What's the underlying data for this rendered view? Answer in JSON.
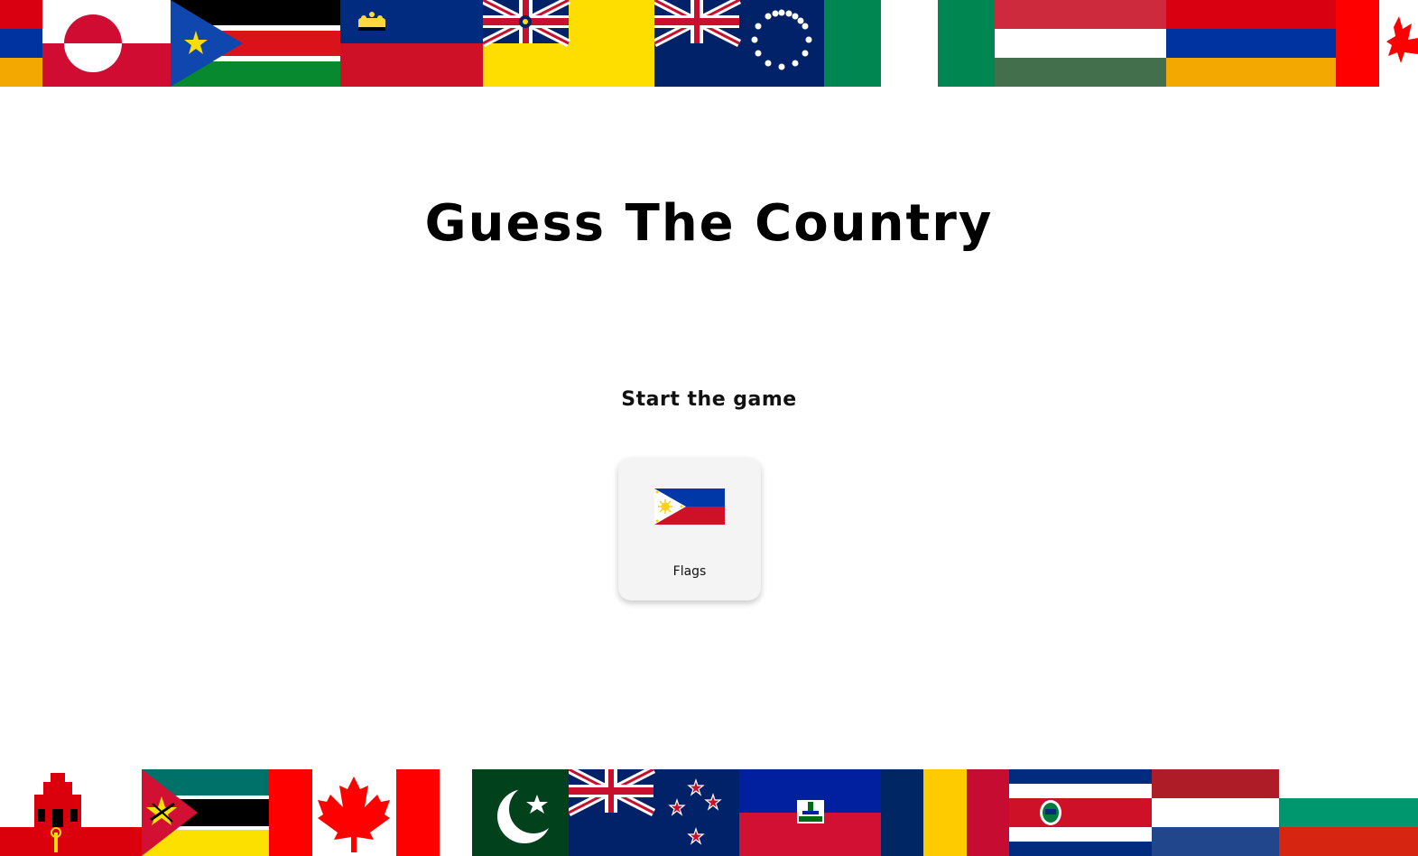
{
  "title": "Guess The Country",
  "subtitle": "Start the game",
  "modes": [
    {
      "label": "Flags",
      "icon": "philippines-flag-icon"
    }
  ],
  "top_flags": [
    "armenia",
    "greenland",
    "south-sudan",
    "liechtenstein",
    "niue",
    "cook-islands",
    "nigeria",
    "hungary",
    "armenia",
    "canada"
  ],
  "bottom_flags": [
    "gibraltar",
    "mozambique",
    "canada",
    "pakistan",
    "new-zealand",
    "haiti",
    "chad",
    "costa-rica",
    "netherlands",
    "bulgaria"
  ],
  "colors": {
    "background": "#ffffff",
    "card_background": "#f4f4f4",
    "text": "#000000"
  }
}
